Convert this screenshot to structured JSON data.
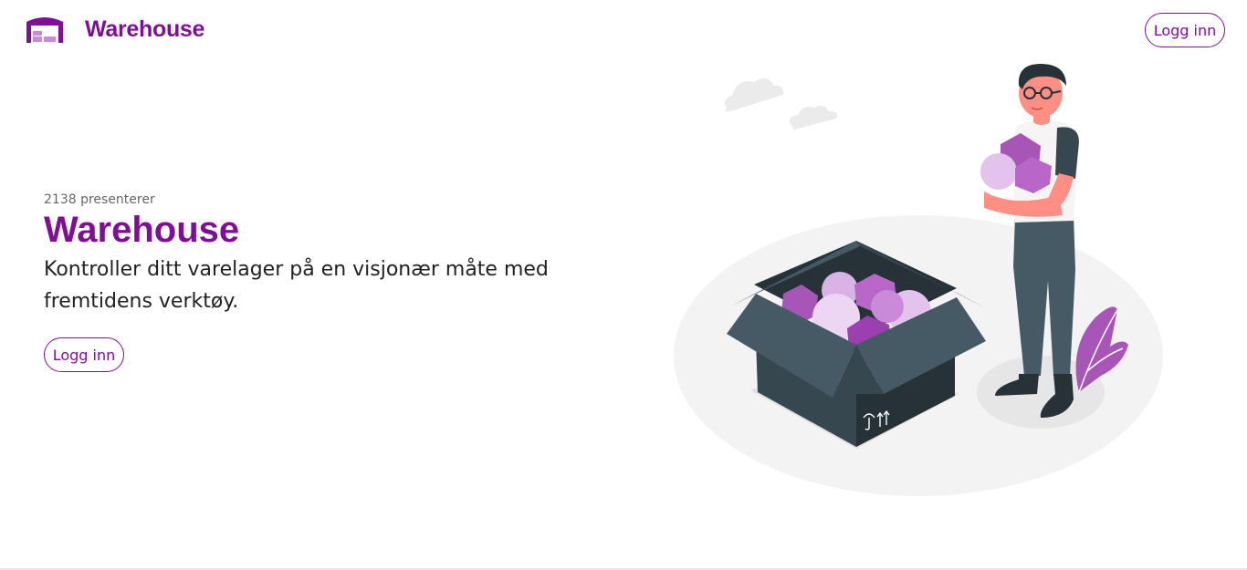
{
  "header": {
    "brand_name": "Warehouse",
    "login_label": "Logg inn",
    "logo_icon": "warehouse-icon"
  },
  "hero": {
    "eyebrow": "2138 presenterer",
    "title": "Warehouse",
    "description": "Kontroller ditt varelager på en visjonær måte med fremtidens verktøy.",
    "login_label": "Logg inn"
  },
  "illustration": {
    "name": "person-with-box-illustration"
  },
  "colors": {
    "brand": "#7f0f97",
    "accent_light": "#c98bd9",
    "box_dark": "#37474f",
    "box_mid": "#455a64"
  }
}
